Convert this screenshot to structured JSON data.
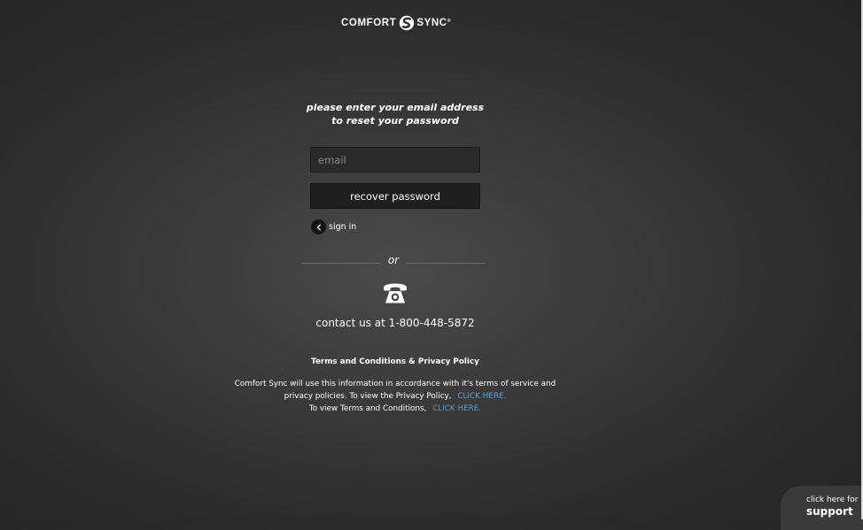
{
  "brand": {
    "name_left": "COMFORT",
    "name_right": "SYNC",
    "trademark": "®",
    "icon": "comfort-sync-logo-icon"
  },
  "reset": {
    "prompt": "please enter your email address to reset your password",
    "email_placeholder": "email",
    "email_value": "",
    "recover_button": "recover password",
    "sign_in_label": "sign in",
    "sign_in_icon": "chevron-left-icon"
  },
  "divider": {
    "text": "or"
  },
  "contact": {
    "icon": "telephone-icon",
    "text": "contact us at 1-800-448-5872"
  },
  "terms": {
    "title": "Terms and Conditions & Privacy Policy",
    "line1": "Comfort Sync will use this information in accordance with it's terms of service and",
    "line2": "privacy policies. To view the Privacy Policy,",
    "privacy_link": "CLICK HERE.",
    "line3": "To view Terms and Conditions,",
    "terms_link": "CLICK HERE."
  },
  "support": {
    "small_text": "click here for",
    "big_text": "support"
  },
  "colors": {
    "background": "#2f2f2f",
    "link": "#4fa0e0",
    "input_bg": "#2a2a2a",
    "button_bg": "#1e1e1e"
  }
}
